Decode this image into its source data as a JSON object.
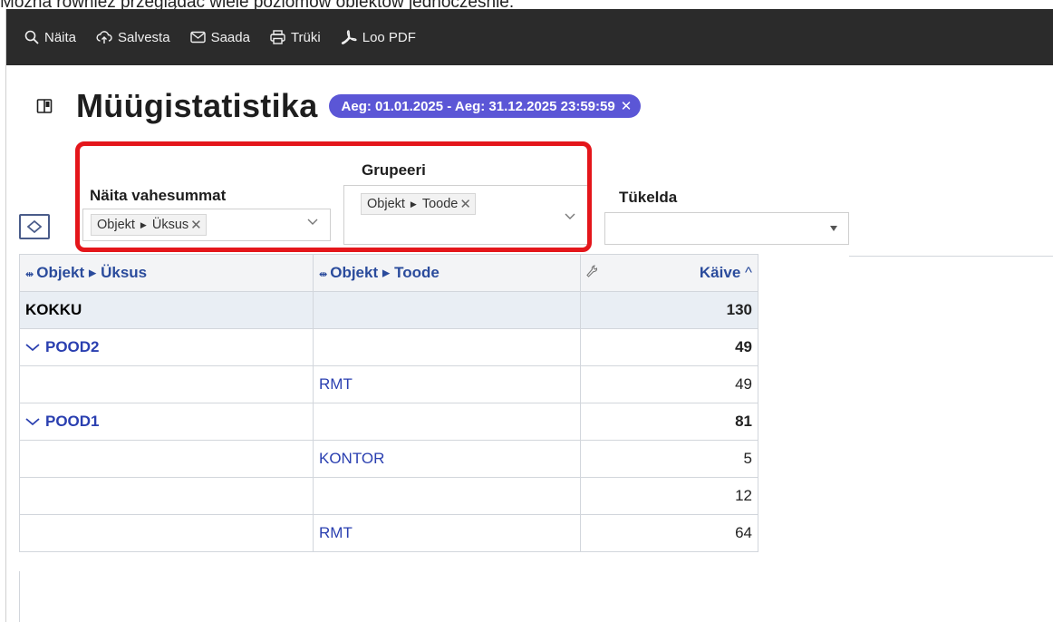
{
  "caption": "Można również przeglądać wiele poziomów obiektów jednocześnie.",
  "toolbar": {
    "items": [
      {
        "label": "Näita",
        "icon": "search-icon"
      },
      {
        "label": "Salvesta",
        "icon": "cloud-upload-icon"
      },
      {
        "label": "Saada",
        "icon": "envelope-icon"
      },
      {
        "label": "Trüki",
        "icon": "printer-icon"
      },
      {
        "label": "Loo PDF",
        "icon": "pdf-icon"
      }
    ]
  },
  "page": {
    "title": "Müügistatistika",
    "date_filter": "Aeg: 01.01.2025 - Aeg: 31.12.2025 23:59:59",
    "date_filter_close": "✕"
  },
  "filters": {
    "subtotals": {
      "label": "Näita vahesummat",
      "tag_left": "Objekt",
      "tag_right": "Üksus"
    },
    "group": {
      "label": "Grupeeri",
      "tag_left": "Objekt",
      "tag_right": "Toode"
    },
    "split": {
      "label": "Tükelda",
      "value": ""
    }
  },
  "table": {
    "headers": [
      "Objekt ▸ Üksus",
      "Objekt ▸ Toode",
      "Käive"
    ],
    "total": {
      "label": "KOKKU",
      "value": "130"
    },
    "groups": [
      {
        "name": "POOD2",
        "value": "49",
        "rows": [
          {
            "product": "RMT",
            "value": "49"
          }
        ]
      },
      {
        "name": "POOD1",
        "value": "81",
        "rows": [
          {
            "product": "KONTOR",
            "value": "5"
          },
          {
            "product": "",
            "value": "12"
          },
          {
            "product": "RMT",
            "value": "64"
          }
        ]
      }
    ]
  },
  "colors": {
    "toolbar_bg": "#2b2b2b",
    "chip_bg": "#5b56d6",
    "highlight": "#e4161b",
    "link": "#2a3fb0"
  }
}
